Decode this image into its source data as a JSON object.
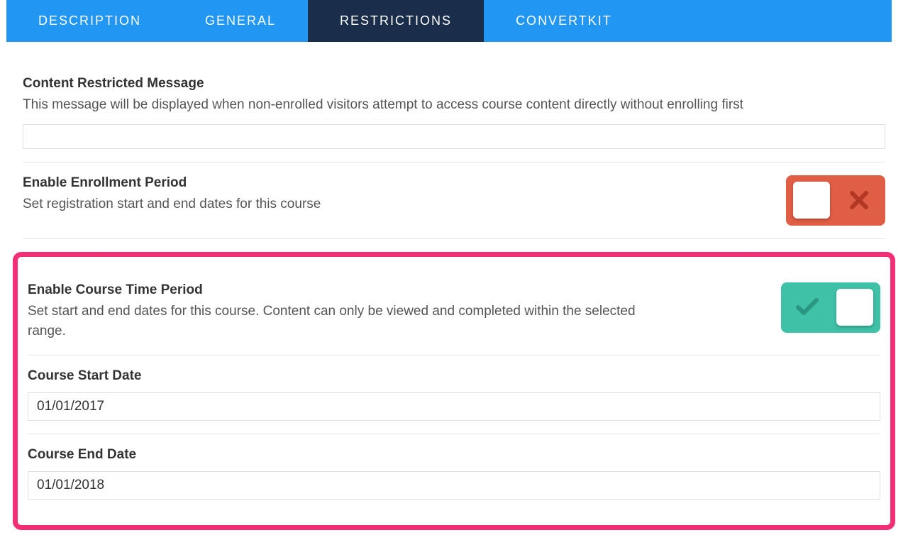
{
  "tabs": {
    "description": "DESCRIPTION",
    "general": "GENERAL",
    "restrictions": "RESTRICTIONS",
    "convertkit": "CONVERTKIT"
  },
  "restricted_message": {
    "title": "Content Restricted Message",
    "desc": "This message will be displayed when non-enrolled visitors attempt to access course content directly without enrolling first",
    "value": ""
  },
  "enrollment_period": {
    "title": "Enable Enrollment Period",
    "desc": "Set registration start and end dates for this course"
  },
  "course_time_period": {
    "title": "Enable Course Time Period",
    "desc": "Set start and end dates for this course. Content can only be viewed and completed within the selected range."
  },
  "start_date": {
    "title": "Course Start Date",
    "value": "01/01/2017"
  },
  "end_date": {
    "title": "Course End Date",
    "value": "01/01/2018"
  }
}
